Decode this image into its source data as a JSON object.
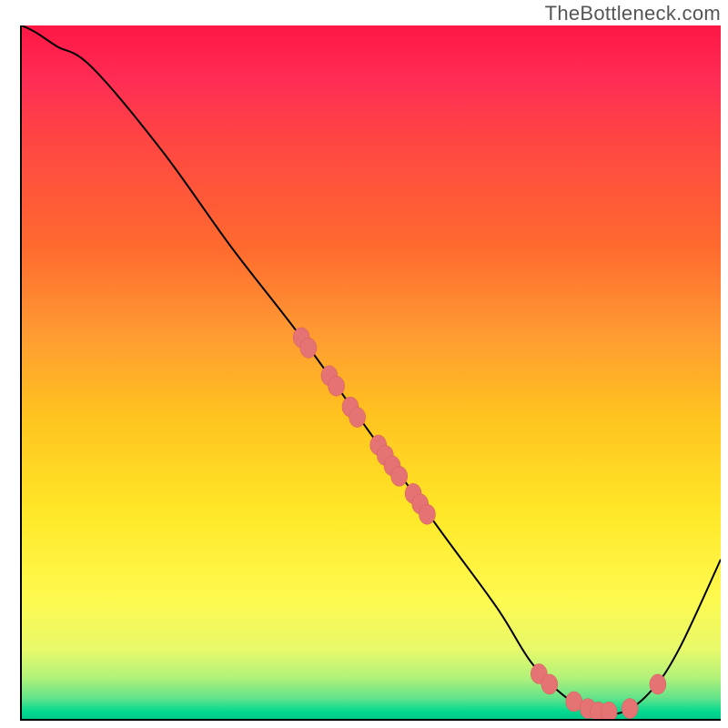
{
  "watermark": "TheBottleneck.com",
  "chart_data": {
    "type": "line",
    "title": "",
    "xlabel": "",
    "ylabel": "",
    "xlim": [
      0,
      100
    ],
    "ylim": [
      0,
      100
    ],
    "series": [
      {
        "name": "curve",
        "x": [
          0,
          2,
          5,
          10,
          20,
          30,
          40,
          50,
          60,
          68,
          73,
          78,
          82,
          86,
          90,
          94,
          100
        ],
        "y": [
          100,
          99,
          97,
          94,
          82,
          68,
          55,
          41,
          27,
          16,
          8,
          3,
          1,
          1,
          4,
          10,
          23
        ]
      }
    ],
    "markers": [
      {
        "x": 40,
        "y": 55
      },
      {
        "x": 41,
        "y": 53.5
      },
      {
        "x": 44,
        "y": 49.5
      },
      {
        "x": 45,
        "y": 48
      },
      {
        "x": 47,
        "y": 45
      },
      {
        "x": 48,
        "y": 43.5
      },
      {
        "x": 51,
        "y": 39.5
      },
      {
        "x": 52,
        "y": 38
      },
      {
        "x": 53,
        "y": 36.5
      },
      {
        "x": 54,
        "y": 35
      },
      {
        "x": 56,
        "y": 32.5
      },
      {
        "x": 57,
        "y": 31
      },
      {
        "x": 58,
        "y": 29.5
      },
      {
        "x": 74,
        "y": 6.5
      },
      {
        "x": 75.5,
        "y": 5
      },
      {
        "x": 79,
        "y": 2.5
      },
      {
        "x": 81,
        "y": 1.5
      },
      {
        "x": 82.5,
        "y": 1
      },
      {
        "x": 84,
        "y": 1
      },
      {
        "x": 87,
        "y": 1.5
      },
      {
        "x": 91,
        "y": 5
      }
    ]
  }
}
